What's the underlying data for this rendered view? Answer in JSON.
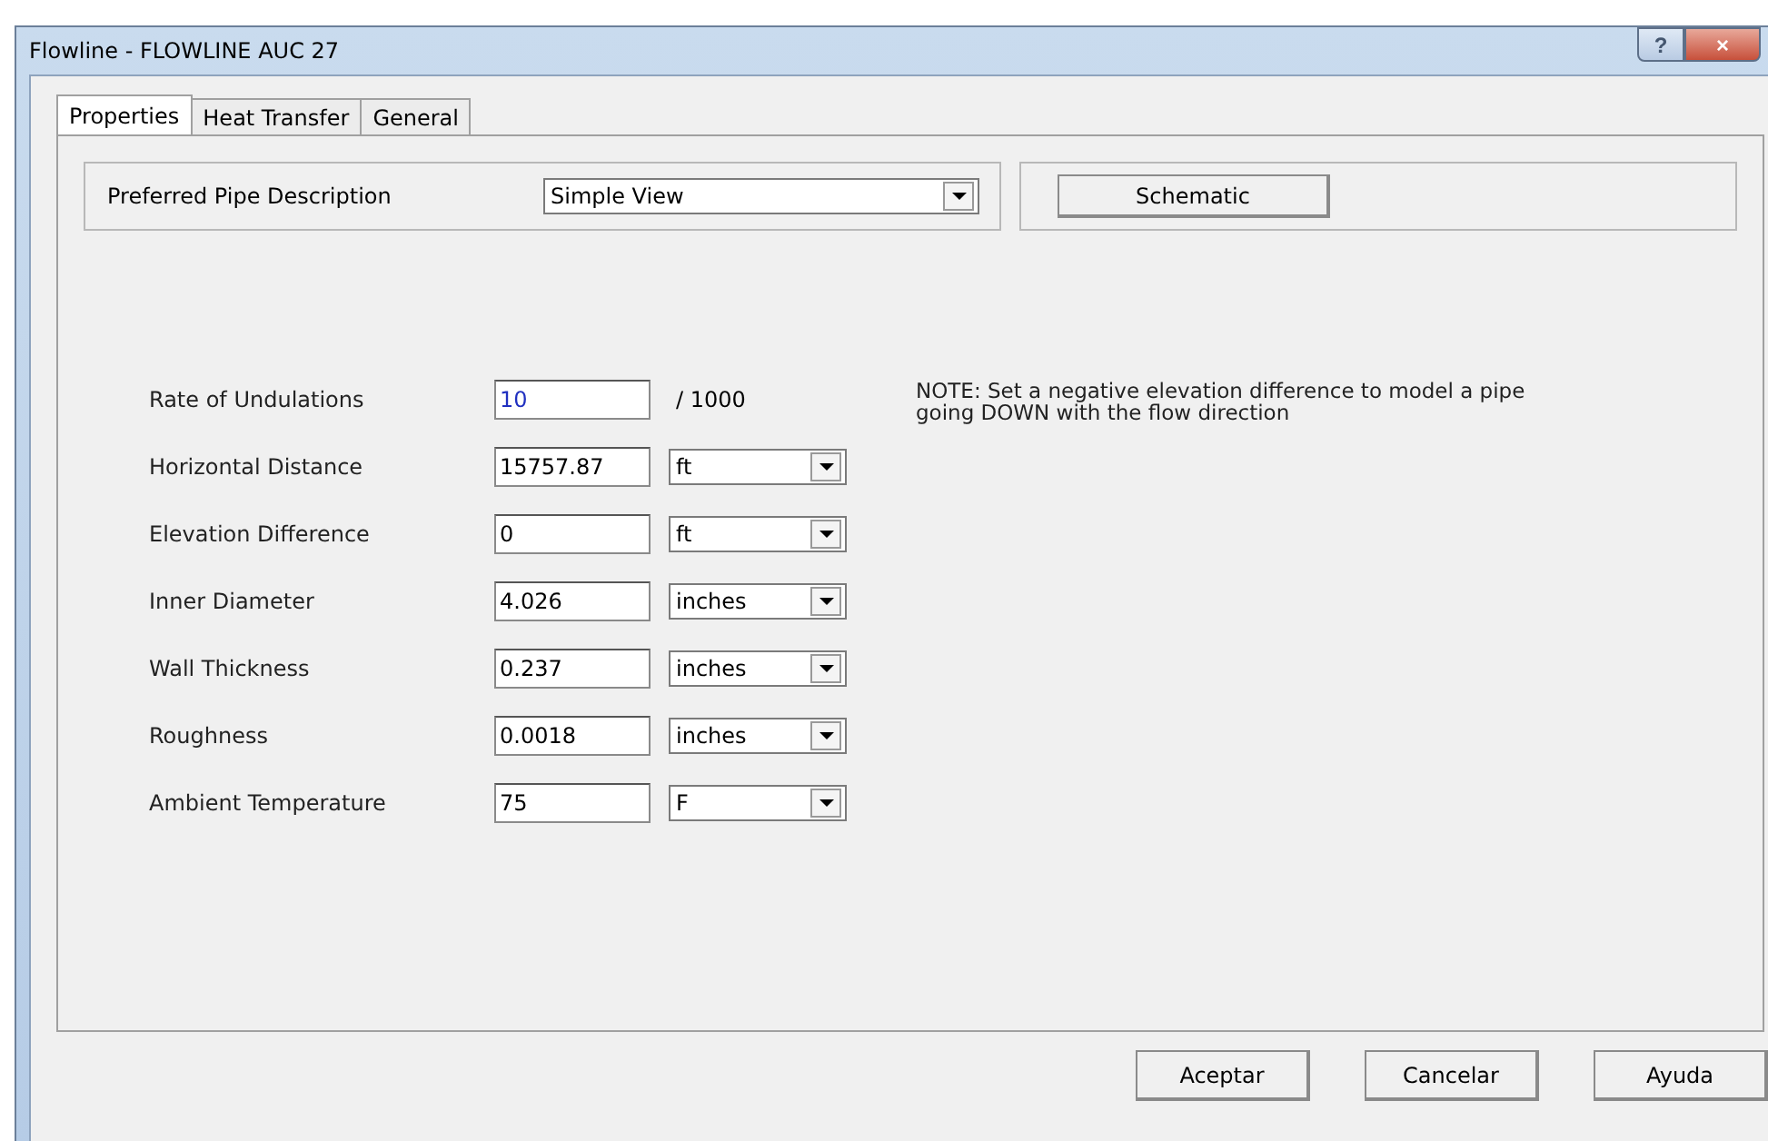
{
  "window": {
    "title": "Flowline - FLOWLINE AUC 27",
    "help_button": "?",
    "close_button": "×"
  },
  "tabs": [
    {
      "label": "Properties",
      "selected": true
    },
    {
      "label": "Heat Transfer",
      "selected": false
    },
    {
      "label": "General",
      "selected": false
    }
  ],
  "pipe_description": {
    "label": "Preferred Pipe Description",
    "value": "Simple View",
    "button": "Schematic"
  },
  "fields": [
    {
      "label": "Rate of Undulations",
      "value": "10",
      "kind": "suffix",
      "suffix": "/ 1000",
      "focused": true
    },
    {
      "label": "Horizontal Distance",
      "value": "15757.87",
      "kind": "unit",
      "unit": "ft",
      "focused": false
    },
    {
      "label": "Elevation Difference",
      "value": "0",
      "kind": "unit",
      "unit": "ft",
      "focused": false
    },
    {
      "label": "Inner Diameter",
      "value": "4.026",
      "kind": "unit",
      "unit": "inches",
      "focused": false
    },
    {
      "label": "Wall Thickness",
      "value": "0.237",
      "kind": "unit",
      "unit": "inches",
      "focused": false
    },
    {
      "label": "Roughness",
      "value": "0.0018",
      "kind": "unit",
      "unit": "inches",
      "focused": false
    },
    {
      "label": "Ambient Temperature",
      "value": "75",
      "kind": "unit",
      "unit": "F",
      "focused": false
    }
  ],
  "note": "NOTE: Set a negative elevation difference to model a pipe going DOWN with the flow direction",
  "buttons": [
    "Aceptar",
    "Cancelar",
    "Ayuda"
  ]
}
